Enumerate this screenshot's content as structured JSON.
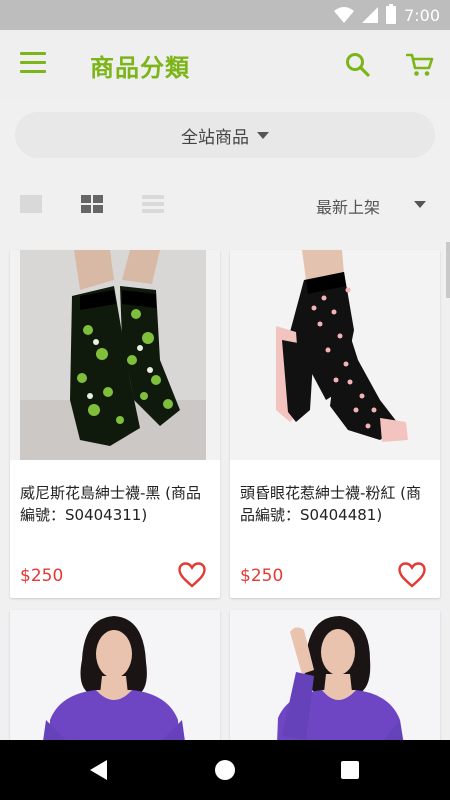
{
  "status_bar": {
    "time": "7:00"
  },
  "app_bar": {
    "title": "商品分類"
  },
  "category": {
    "selected": "全站商品"
  },
  "toolbar": {
    "sort_label": "最新上架"
  },
  "colors": {
    "brand_green": "#7cb518",
    "price_red": "#e53935",
    "favorite_red": "#e53935"
  },
  "products": [
    {
      "name": "威尼斯花島紳士襪-黑 (商品編號：S0404311)",
      "price": "$250",
      "image": "black-floral-socks-photo",
      "favorite": false
    },
    {
      "name": "頭昏眼花惹紳士襪-粉紅 (商品編號：S0404481)",
      "price": "$250",
      "image": "black-pink-dotted-socks-photo",
      "favorite": false
    },
    {
      "name": "",
      "price": "",
      "image": "woman-purple-longsleeve-photo"
    },
    {
      "name": "",
      "price": "",
      "image": "woman-purple-longsleeve-photo-2"
    }
  ]
}
